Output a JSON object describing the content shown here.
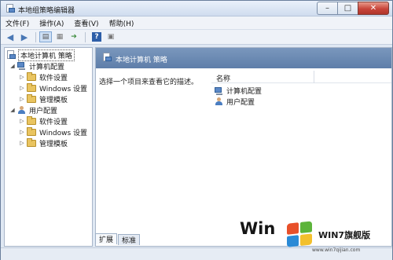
{
  "window": {
    "title": "本地组策略编辑器"
  },
  "menubar": {
    "items": [
      "文件(F)",
      "操作(A)",
      "查看(V)",
      "帮助(H)"
    ]
  },
  "tree": {
    "root": "本地计算机 策略",
    "computer_config": "计算机配置",
    "computer_children": [
      "软件设置",
      "Windows 设置",
      "管理模板"
    ],
    "user_config": "用户配置",
    "user_children": [
      "软件设置",
      "Windows 设置",
      "管理模板"
    ]
  },
  "main": {
    "header_title": "本地计算机 策略",
    "description": "选择一个项目来查看它的描述。",
    "column_name": "名称",
    "items": [
      "计算机配置",
      "用户配置"
    ]
  },
  "tabs": [
    "扩展",
    "标准"
  ],
  "watermark": {
    "win": "Win",
    "brand": "WIN7旗舰版",
    "url": "www.win7qijian.com"
  },
  "colors": {
    "header_band": "#6f8cb5",
    "close_button": "#c8453a"
  }
}
